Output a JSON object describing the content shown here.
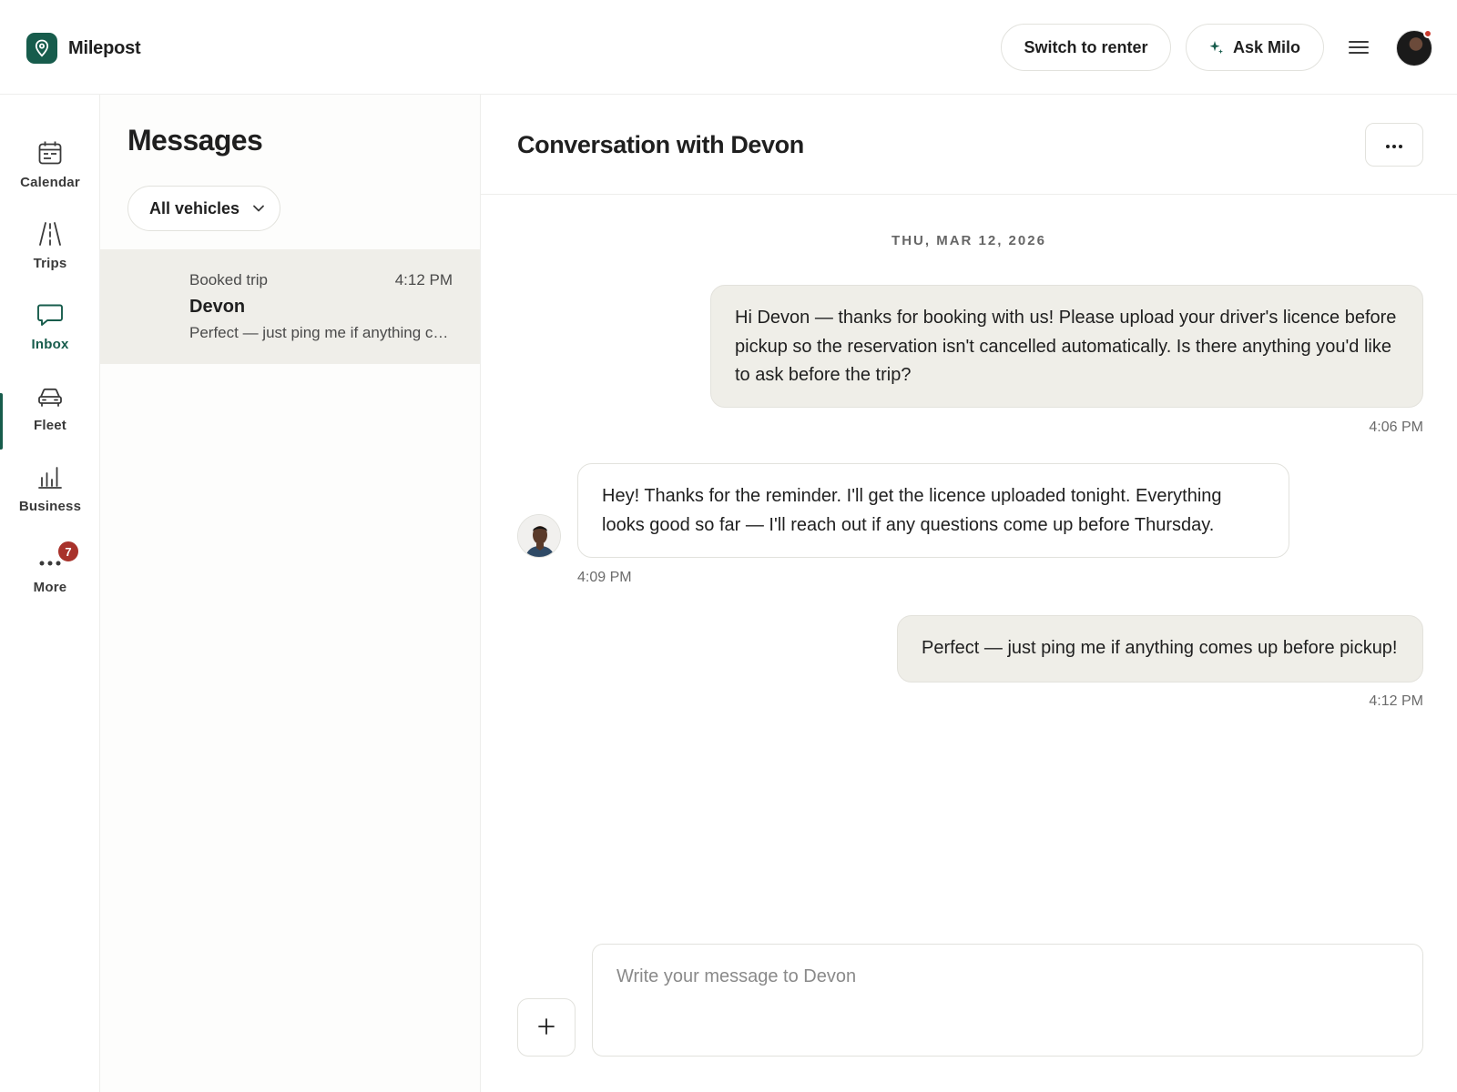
{
  "app": {
    "name": "Milepost",
    "brand_color": "#175c4c",
    "logo_icon": "map-pin-icon"
  },
  "topbar": {
    "switch_label": "Switch to renter",
    "ask_label": "Ask Milo",
    "ask_icon": "sparkle-icon",
    "menu_icon": "hamburger-menu-icon",
    "avatar_icon": "user-avatar"
  },
  "nav": {
    "items": [
      {
        "label": "Calendar",
        "icon": "calendar-icon"
      },
      {
        "label": "Trips",
        "icon": "road-icon"
      },
      {
        "label": "Inbox",
        "icon": "chat-bubble-icon",
        "active": true
      },
      {
        "label": "Fleet",
        "icon": "car-icon"
      },
      {
        "label": "Business",
        "icon": "bar-chart-icon"
      },
      {
        "label": "More",
        "icon": "more-dots-icon",
        "badge": "7"
      }
    ],
    "badge_color": "#a8322b"
  },
  "messages": {
    "title": "Messages",
    "filter_label": "All vehicles",
    "threads": [
      {
        "subtitle": "Booked trip",
        "time": "4:12 PM",
        "name": "Devon",
        "preview": "Perfect — just ping me if anything comes up before pickup!"
      }
    ]
  },
  "conversation": {
    "title": "Conversation with Devon",
    "date": "THU, MAR 12, 2026",
    "messages": [
      {
        "direction": "outgoing",
        "text": "Hi Devon — thanks for booking with us! Please upload your driver's licence before pickup so the reservation isn't cancelled automatically. Is there anything you'd like to ask before the trip?",
        "time": "4:06 PM"
      },
      {
        "direction": "incoming",
        "text": "Hey! Thanks for the reminder. I'll get the licence uploaded tonight. Everything looks good so far — I'll reach out if any questions come up before Thursday.",
        "time": "4:09 PM"
      },
      {
        "direction": "outgoing",
        "text": "Perfect — just ping me if anything comes up before pickup!",
        "time": "4:12 PM"
      }
    ],
    "composer_placeholder": "Write your message to Devon"
  }
}
